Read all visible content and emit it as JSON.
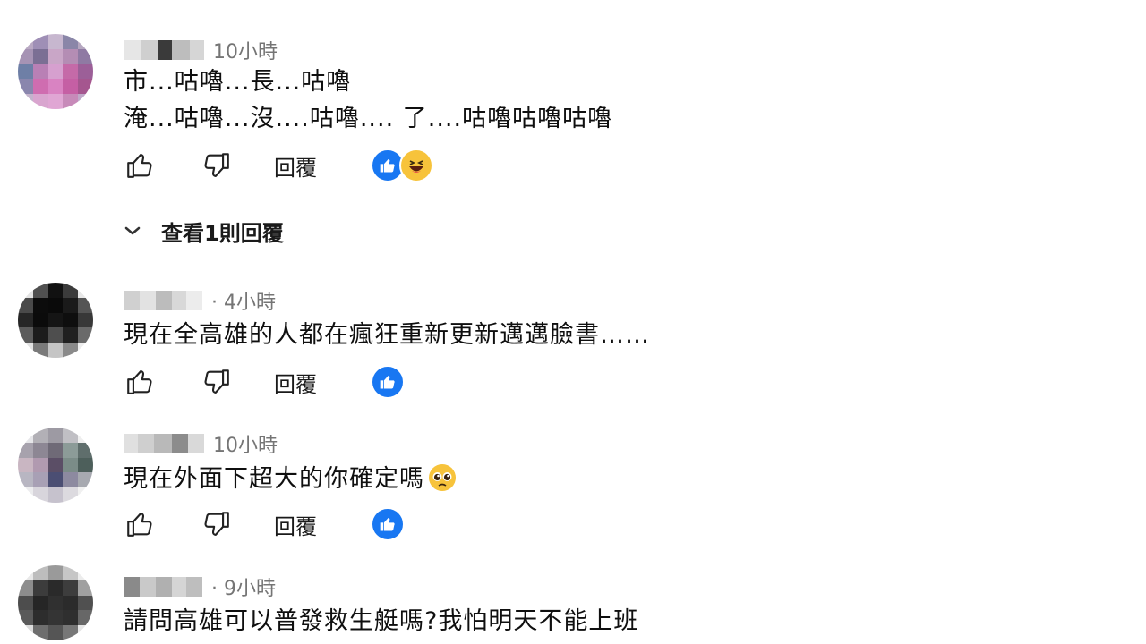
{
  "comments": [
    {
      "time": "10小時",
      "lines": [
        "市...咕嚕...長...咕嚕",
        "淹...咕嚕...沒....咕嚕.... 了....咕嚕咕嚕咕嚕"
      ],
      "reply_label": "回覆",
      "reactions": [
        "like-reaction",
        "haha-reaction"
      ],
      "view_replies_label": "查看1則回覆"
    },
    {
      "time": "· 4小時",
      "lines": [
        "現在全高雄的人都在瘋狂重新更新邁邁臉書……"
      ],
      "reply_label": "回覆",
      "reactions": [
        "like-reaction"
      ]
    },
    {
      "time": "10小時",
      "lines": [
        "現在外面下超大的你確定嗎"
      ],
      "trailing_emoji": "pleading-face-emoji",
      "reply_label": "回覆",
      "reactions": [
        "like-reaction"
      ]
    },
    {
      "time": "· 9小時",
      "lines": [
        "請問高雄可以普發救生艇嗎?我怕明天不能上班"
      ]
    }
  ],
  "icons": {
    "like": "thumbs-up-icon",
    "dislike": "thumbs-down-icon",
    "chevron": "chevron-down-icon"
  },
  "colors": {
    "like_reaction": "#1877f2",
    "haha_reaction": "#f7c33b",
    "time_text": "#757575"
  }
}
